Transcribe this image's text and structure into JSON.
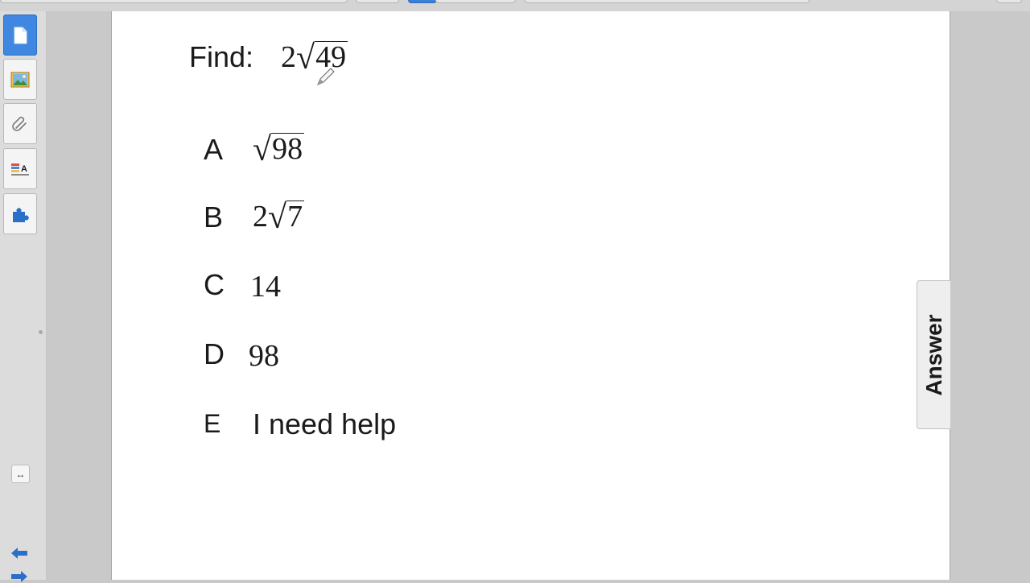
{
  "question": {
    "prompt_label": "Find:",
    "expression": {
      "coefficient": "2",
      "radicand": "49"
    }
  },
  "options": [
    {
      "letter": "A",
      "value": "98",
      "format": "sqrt"
    },
    {
      "letter": "B",
      "coefficient": "2",
      "value": "7",
      "format": "coef-sqrt"
    },
    {
      "letter": "C",
      "value": "14",
      "format": "number"
    },
    {
      "letter": "D",
      "value": "98",
      "format": "number"
    },
    {
      "letter": "E",
      "value": "I need help",
      "format": "text"
    }
  ],
  "answer_tab": {
    "label": "Answer"
  },
  "sidebar": {
    "icons": [
      "page-sorter-icon",
      "gallery-icon",
      "attachments-icon",
      "properties-icon",
      "add-ons-icon"
    ],
    "collapse_glyph": "↔"
  },
  "colors": {
    "accent": "#3f87e0",
    "page": "#ffffff",
    "background": "#c9c9c9"
  }
}
